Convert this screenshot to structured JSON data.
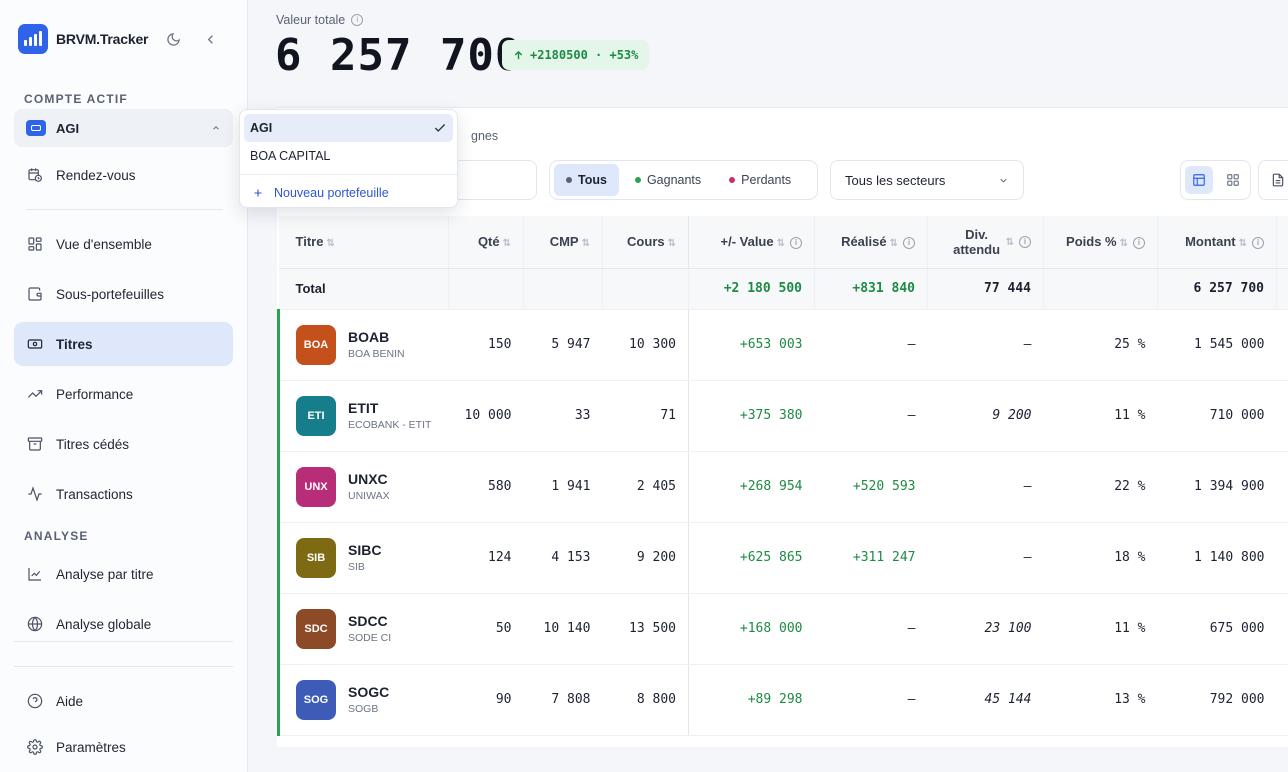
{
  "brand": {
    "name": "BRVM.Tracker"
  },
  "sidebar": {
    "account_section": "COMPTE ACTIF",
    "account_selected": "AGI",
    "items": [
      {
        "label": "Rendez-vous",
        "icon": "calendar-clock-icon"
      },
      {
        "label": "Vue d'ensemble",
        "icon": "grid-icon"
      },
      {
        "label": "Sous-portefeuilles",
        "icon": "wallet-icon"
      },
      {
        "label": "Titres",
        "icon": "ticket-icon"
      },
      {
        "label": "Performance",
        "icon": "trend-up-icon"
      },
      {
        "label": "Titres cédés",
        "icon": "archive-icon"
      },
      {
        "label": "Transactions",
        "icon": "activity-icon"
      }
    ],
    "analyse_section": "ANALYSE",
    "analyse_items": [
      {
        "label": "Analyse par titre",
        "icon": "line-chart-icon"
      },
      {
        "label": "Analyse globale",
        "icon": "globe-icon"
      }
    ],
    "footer_items": [
      {
        "label": "Aide",
        "icon": "help-icon"
      },
      {
        "label": "Paramètres",
        "icon": "settings-icon"
      }
    ]
  },
  "dropdown": {
    "options": [
      "AGI",
      "BOA CAPITAL"
    ],
    "selected": "AGI",
    "new_label": "Nouveau portefeuille"
  },
  "summary": {
    "label": "Valeur totale",
    "value": "6 257 700",
    "gain": "+2180500 · +53%"
  },
  "toolbar": {
    "lines_text": "gnes",
    "filters": [
      {
        "label": "Tous",
        "color": "#5a6272"
      },
      {
        "label": "Gagnants",
        "color": "#2aa252"
      },
      {
        "label": "Perdants",
        "color": "#c8306c"
      }
    ],
    "sector": "Tous les secteurs"
  },
  "table": {
    "headers": [
      "Titre",
      "Qté",
      "CMP",
      "Cours",
      "+/- Value",
      "Réalisé",
      "Div. attendu",
      "Poids %",
      "Montant"
    ],
    "total": {
      "label": "Total",
      "pv": "+2 180 500",
      "realise": "+831 840",
      "div": "77 444",
      "montant": "6 257 700"
    },
    "rows": [
      {
        "logo": "BOA",
        "color": "#c4501c",
        "ticker": "BOAB",
        "name": "BOA BENIN",
        "qte": "150",
        "cmp": "5 947",
        "cours": "10 300",
        "pv": "+653 003",
        "realise": "—",
        "div": "—",
        "poids": "25 %",
        "montant": "1 545 000"
      },
      {
        "logo": "ETI",
        "color": "#157e8a",
        "ticker": "ETIT",
        "name": "ECOBANK - ETIT",
        "qte": "10 000",
        "cmp": "33",
        "cours": "71",
        "pv": "+375 380",
        "realise": "—",
        "div": "9 200",
        "poids": "11 %",
        "montant": "710 000"
      },
      {
        "logo": "UNX",
        "color": "#b72d78",
        "ticker": "UNXC",
        "name": "UNIWAX",
        "qte": "580",
        "cmp": "1 941",
        "cours": "2 405",
        "pv": "+268 954",
        "realise": "+520 593",
        "div": "—",
        "poids": "22 %",
        "montant": "1 394 900"
      },
      {
        "logo": "SIB",
        "color": "#7d6a13",
        "ticker": "SIBC",
        "name": "SIB",
        "qte": "124",
        "cmp": "4 153",
        "cours": "9 200",
        "pv": "+625 865",
        "realise": "+311 247",
        "div": "—",
        "poids": "18 %",
        "montant": "1 140 800"
      },
      {
        "logo": "SDC",
        "color": "#8c4a26",
        "ticker": "SDCC",
        "name": "SODE CI",
        "qte": "50",
        "cmp": "10 140",
        "cours": "13 500",
        "pv": "+168 000",
        "realise": "—",
        "div": "23 100",
        "poids": "11 %",
        "montant": "675 000"
      },
      {
        "logo": "SOG",
        "color": "#3d5cb8",
        "ticker": "SOGC",
        "name": "SOGB",
        "qte": "90",
        "cmp": "7 808",
        "cours": "8 800",
        "pv": "+89 298",
        "realise": "—",
        "div": "45 144",
        "poids": "13 %",
        "montant": "792 000"
      }
    ]
  }
}
